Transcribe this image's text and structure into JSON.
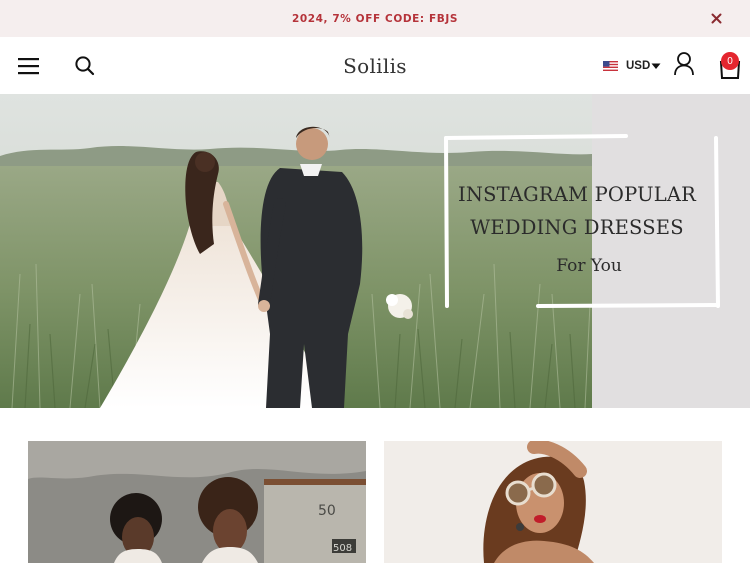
{
  "announcement": {
    "text": "2024, 7% OFF CODE: FBJS",
    "close_icon": "close-icon"
  },
  "header": {
    "menu_icon": "hamburger-menu-icon",
    "search_icon": "search-icon",
    "logo_text": "Solilis",
    "currency": {
      "flag_icon": "us-flag-icon",
      "label": "USD"
    },
    "account_icon": "user-icon",
    "cart_icon": "shopping-bag-icon",
    "cart_count": "0"
  },
  "hero": {
    "heading_line1": "INSTAGRAM POPULAR",
    "heading_line2": "WEDDING DRESSES",
    "subheading": "For You"
  },
  "tiles": [
    {
      "name": "category-tile-bridesmaids"
    },
    {
      "name": "category-tile-prom"
    }
  ],
  "colors": {
    "promo_background": "#f5eeee",
    "promo_text": "#b5333a",
    "cart_badge": "#e4262f",
    "hero_panel": "#e1dfe0"
  }
}
